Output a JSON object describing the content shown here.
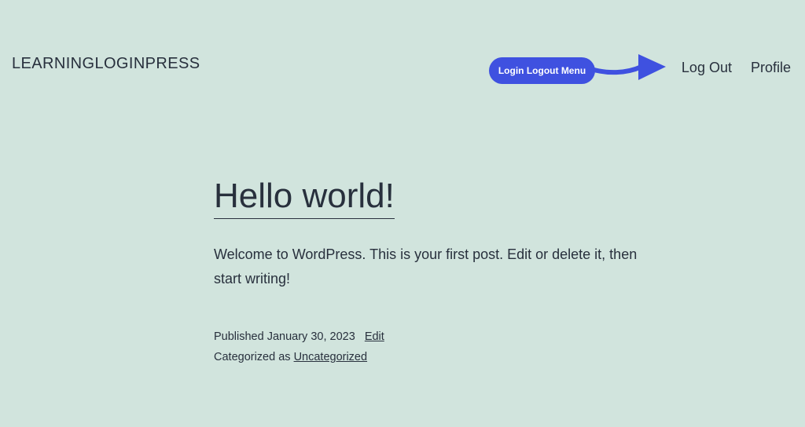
{
  "site": {
    "title": "LEARNINGLOGINPRESS"
  },
  "annotation": {
    "label": "Login Logout Menu",
    "color": "#3f51e0"
  },
  "nav": {
    "items": [
      {
        "label": "Log Out"
      },
      {
        "label": "Profile"
      }
    ]
  },
  "post": {
    "title": "Hello world!",
    "content": "Welcome to WordPress. This is your first post. Edit or delete it, then start writing!",
    "meta": {
      "published_prefix": "Published",
      "published_date": "January 30, 2023",
      "edit_label": "Edit",
      "categorized_prefix": "Categorized as",
      "category": "Uncategorized"
    }
  },
  "colors": {
    "background": "#d1e4dd",
    "text": "#28303d"
  }
}
